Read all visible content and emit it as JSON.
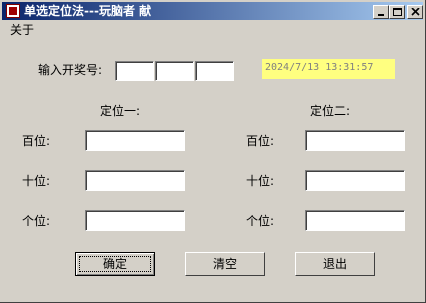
{
  "window": {
    "title": "单选定位法---玩脑者 献"
  },
  "menu": {
    "about": "关于"
  },
  "input_label": "输入开奖号:",
  "timestamp": "2024/7/13 13:31:57",
  "group1": {
    "title": "定位一:",
    "hundreds": "百位:",
    "tens": "十位:",
    "ones": "个位:"
  },
  "group2": {
    "title": "定位二:",
    "hundreds": "百位:",
    "tens": "十位:",
    "ones": "个位:"
  },
  "buttons": {
    "confirm": "确定",
    "clear": "清空",
    "exit": "退出"
  }
}
